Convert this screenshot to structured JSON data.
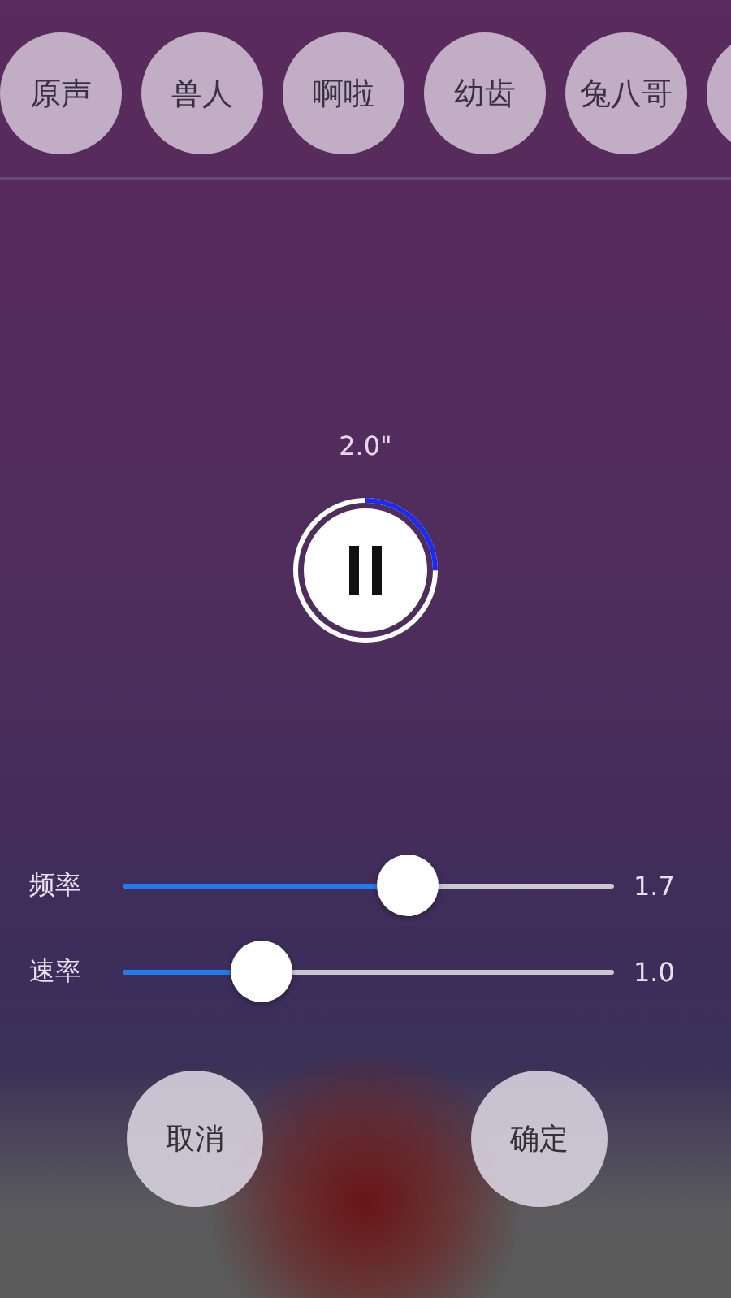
{
  "voices": [
    {
      "label": "原声"
    },
    {
      "label": "兽人"
    },
    {
      "label": "啊啦"
    },
    {
      "label": "幼齿"
    },
    {
      "label": "兔八哥"
    }
  ],
  "timer": {
    "text": "2.0\"",
    "level": 0.25,
    "playing": true
  },
  "sliders": [
    {
      "label": "频率",
      "level": 0.58,
      "reading": "1.7"
    },
    {
      "label": "速率",
      "level": 0.28,
      "reading": "1.0"
    }
  ],
  "buttons": [
    {
      "label": "取消"
    },
    {
      "label": "确定"
    }
  ]
}
